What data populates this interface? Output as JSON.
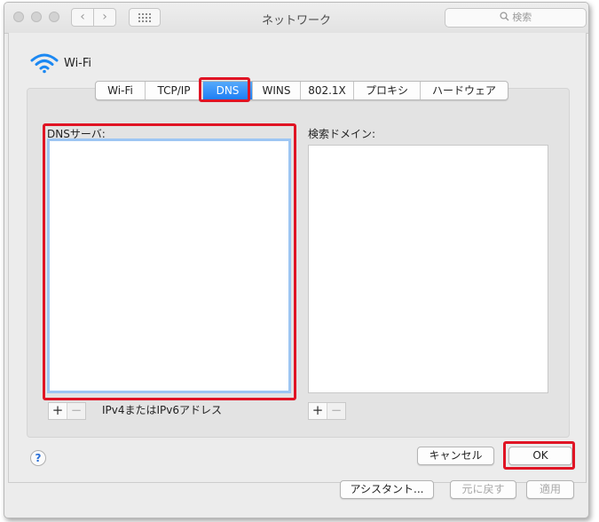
{
  "window": {
    "title": "ネットワーク"
  },
  "search": {
    "placeholder": "検索"
  },
  "nav": {
    "back": "‹",
    "forward": "›"
  },
  "interface": {
    "name": "Wi-Fi"
  },
  "tabs": [
    {
      "label": "Wi-Fi"
    },
    {
      "label": "TCP/IP"
    },
    {
      "label": "DNS",
      "selected": true
    },
    {
      "label": "WINS"
    },
    {
      "label": "802.1X"
    },
    {
      "label": "プロキシ"
    },
    {
      "label": "ハードウェア"
    }
  ],
  "dns": {
    "servers_label": "DNSサーバ:",
    "search_domains_label": "検索ドメイン:",
    "servers": [],
    "search_domains": [],
    "hint": "IPv4またはIPv6アドレス",
    "add": "+",
    "remove": "−"
  },
  "buttons": {
    "help": "?",
    "cancel": "キャンセル",
    "ok": "OK",
    "assistant": "アシスタント...",
    "revert": "元に戻す",
    "apply": "適用"
  },
  "colors": {
    "accent": "#1e7ef5",
    "highlight": "#e01424",
    "focus": "#9dc6f3"
  }
}
